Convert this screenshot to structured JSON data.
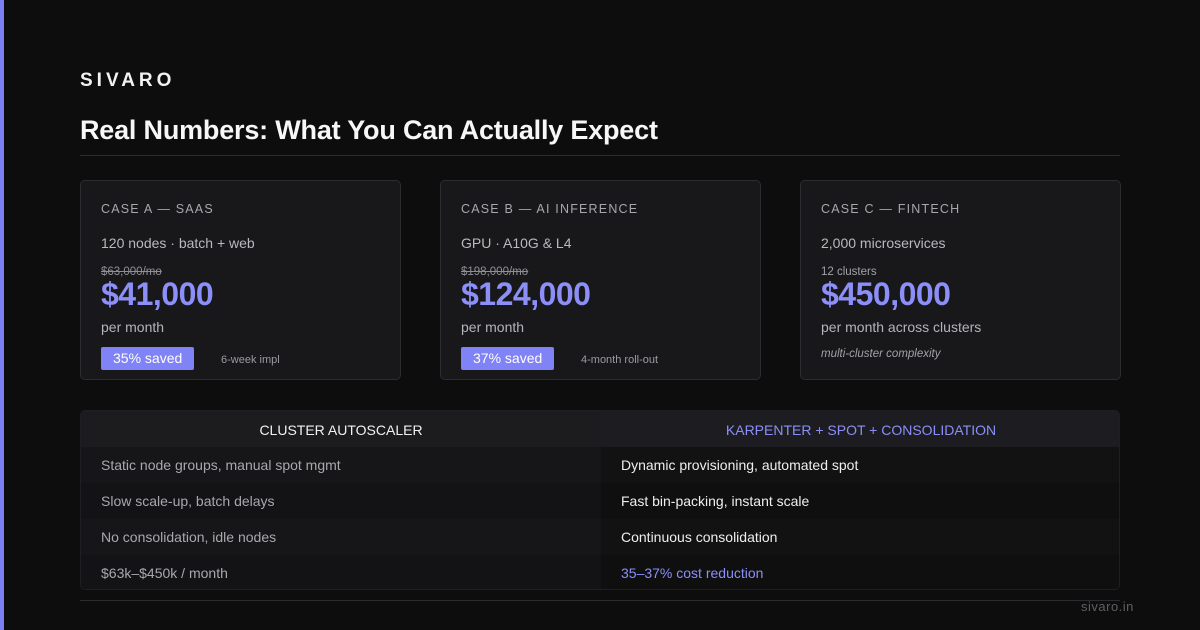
{
  "brand": "SIVARO",
  "title": "Real Numbers: What You Can Actually Expect",
  "cases": [
    {
      "label": "CASE A — SAAS",
      "desc": "120 nodes · batch + web",
      "old_price": "$63,000/mo",
      "price": "$41,000",
      "sub": "per month",
      "badge": "35% saved",
      "meta": "6-week impl"
    },
    {
      "label": "CASE B — AI INFERENCE",
      "desc": "GPU · A10G & L4",
      "old_price": "$198,000/mo",
      "price": "$124,000",
      "sub": "per month",
      "badge": "37% saved",
      "meta": "4-month roll-out"
    },
    {
      "label": "CASE C — FINTECH",
      "desc": "2,000 microservices",
      "note": "12 clusters",
      "price": "$450,000",
      "sub": "per month across clusters",
      "italic": "multi-cluster complexity"
    }
  ],
  "comparison": {
    "left": {
      "heading": "CLUSTER AUTOSCALER",
      "rows": [
        "Static node groups, manual spot mgmt",
        "Slow scale-up, batch delays",
        "No consolidation, idle nodes",
        "$63k–$450k / month"
      ]
    },
    "right": {
      "heading": "KARPENTER + SPOT + CONSOLIDATION",
      "rows": [
        "Dynamic provisioning, automated spot",
        "Fast bin-packing, instant scale",
        "Continuous consolidation",
        "35–37% cost reduction"
      ]
    }
  },
  "footer": "sivaro.in",
  "colors": {
    "accent": "#7b7ff0",
    "highlight": "#8b8ff7",
    "background": "#0d0d0e"
  }
}
